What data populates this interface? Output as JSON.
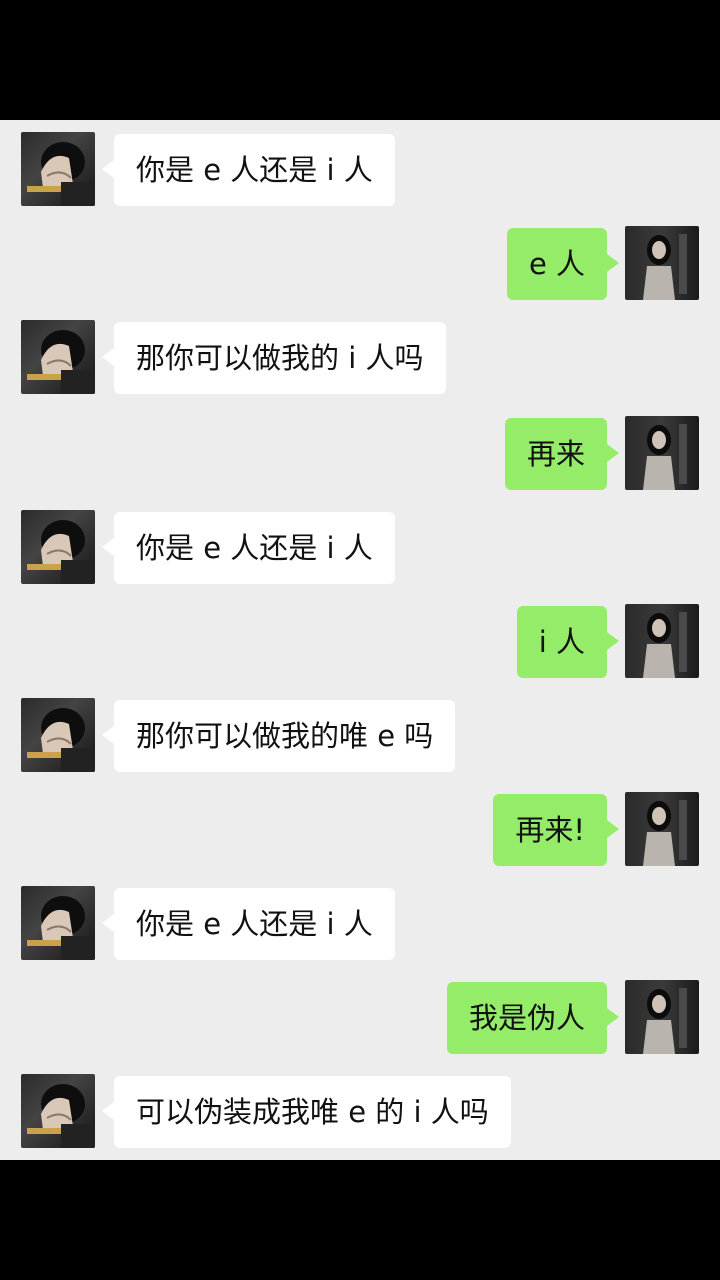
{
  "messages": [
    {
      "side": "left",
      "avatar": "boy-avatar",
      "text": "你是 e 人还是 i 人"
    },
    {
      "side": "right",
      "avatar": "girl-avatar",
      "text": "e 人"
    },
    {
      "side": "left",
      "avatar": "boy-avatar",
      "text": "那你可以做我的 i 人吗"
    },
    {
      "side": "right",
      "avatar": "girl-avatar",
      "text": "再来"
    },
    {
      "side": "left",
      "avatar": "boy-avatar",
      "text": "你是 e 人还是 i 人"
    },
    {
      "side": "right",
      "avatar": "girl-avatar",
      "text": "i 人"
    },
    {
      "side": "left",
      "avatar": "boy-avatar",
      "text": "那你可以做我的唯 e 吗"
    },
    {
      "side": "right",
      "avatar": "girl-avatar",
      "text": "再来!"
    },
    {
      "side": "left",
      "avatar": "boy-avatar",
      "text": "你是 e 人还是 i 人"
    },
    {
      "side": "right",
      "avatar": "girl-avatar",
      "text": "我是伪人"
    },
    {
      "side": "left",
      "avatar": "boy-avatar",
      "text": "可以伪装成我唯 e 的 i 人吗"
    }
  ],
  "colors": {
    "chat_bg": "#ededed",
    "sent_bubble": "#95ec69",
    "received_bubble": "#ffffff",
    "frame": "#000000"
  }
}
